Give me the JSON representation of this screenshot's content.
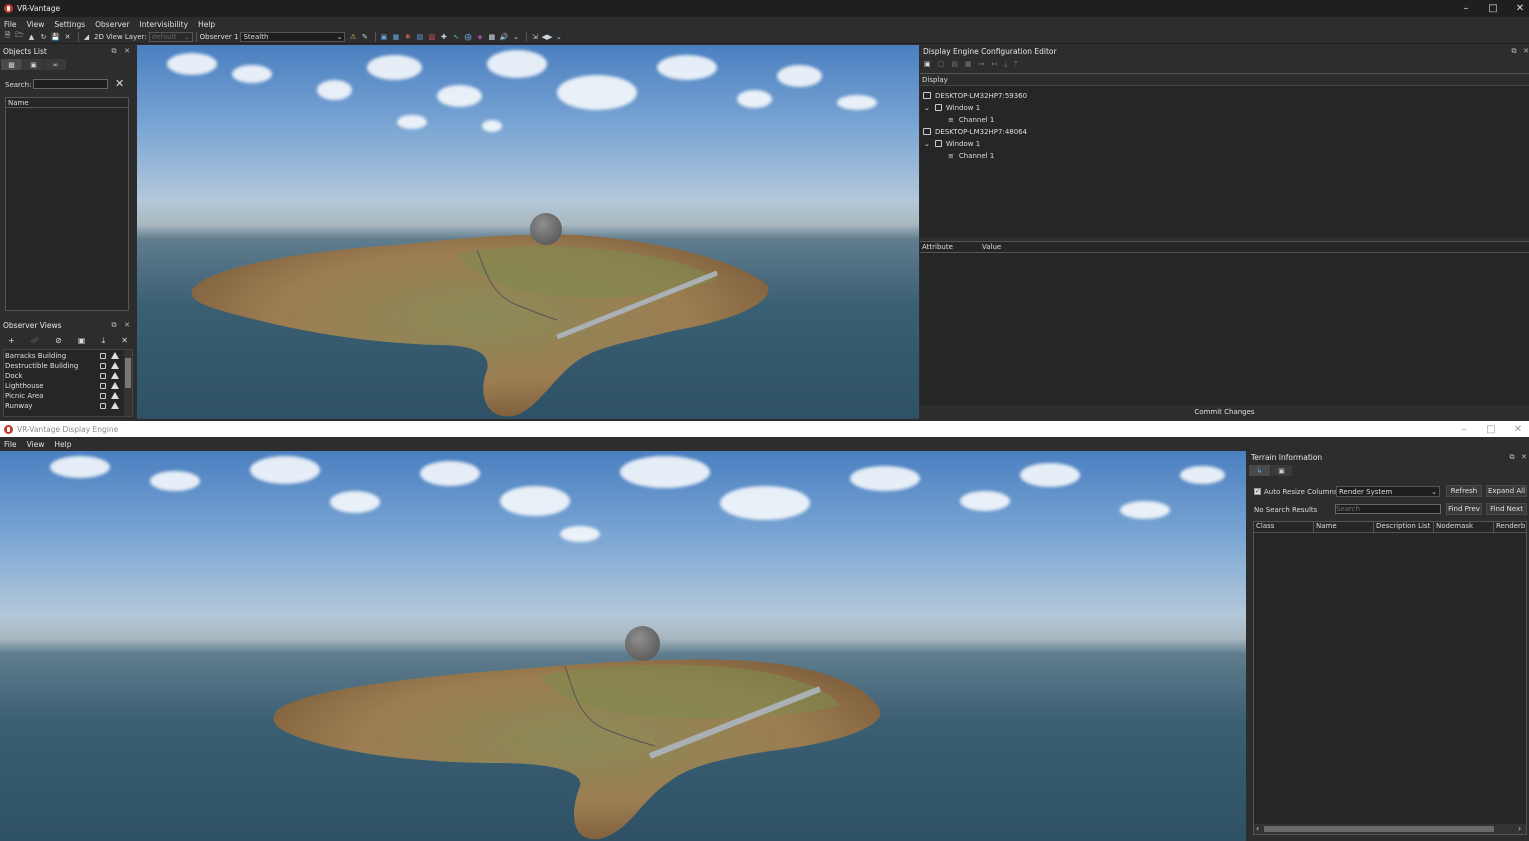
{
  "top_window": {
    "title": "VR-Vantage",
    "menu": [
      "File",
      "View",
      "Settings",
      "Observer",
      "Intervisibility",
      "Help"
    ],
    "toolbar": {
      "view_layer_label": "2D View Layer:",
      "view_layer_value": "default",
      "observer_label": "Observer 1",
      "observer_value": "Stealth"
    },
    "objects_list": {
      "title": "Objects List",
      "search_label": "Search:",
      "search_value": "",
      "column_name": "Name"
    },
    "observer_views": {
      "title": "Observer Views",
      "items": [
        "Barracks Building",
        "Destructible Building",
        "Dock",
        "Lighthouse",
        "Picnic Area",
        "Runway"
      ]
    },
    "display_engine_editor": {
      "title": "Display Engine Configuration Editor",
      "section_label": "Display",
      "tree": [
        {
          "label": "DESKTOP-LM32HP7:59360",
          "level": 0
        },
        {
          "label": "Window 1",
          "level": 1
        },
        {
          "label": "Channel 1",
          "level": 2
        },
        {
          "label": "DESKTOP-LM32HP7:48064",
          "level": 0
        },
        {
          "label": "Window 1",
          "level": 1
        },
        {
          "label": "Channel 1",
          "level": 2
        }
      ],
      "attr_col": "Attribute",
      "value_col": "Value",
      "commit_label": "Commit Changes"
    }
  },
  "bottom_window": {
    "title": "VR-Vantage Display Engine",
    "menu": [
      "File",
      "View",
      "Help"
    ],
    "terrain_info": {
      "title": "Terrain Information",
      "auto_resize_label": "Auto Resize Columns",
      "auto_resize_checked": true,
      "render_select": "Render System",
      "refresh_label": "Refresh",
      "expand_label": "Expand All",
      "search_status": "No Search Results",
      "search_placeholder": "Search",
      "find_prev_label": "Find Prev",
      "find_next_label": "Find Next",
      "columns": [
        "Class",
        "Name",
        "Description List",
        "Nodemask",
        "Renderbin"
      ]
    }
  },
  "colors": {
    "window_bg": "#2d2d2d",
    "titlebar_bg": "#1f1f1f",
    "accent_logo": "#c0392b"
  },
  "icons": {
    "logo": "vr-vantage-logo-icon",
    "minimize": "minimize-icon",
    "maximize": "maximize-icon",
    "close": "close-icon",
    "float": "float-panel-icon",
    "monitor": "monitor-icon",
    "window": "window-icon",
    "channel": "channel-icon"
  }
}
